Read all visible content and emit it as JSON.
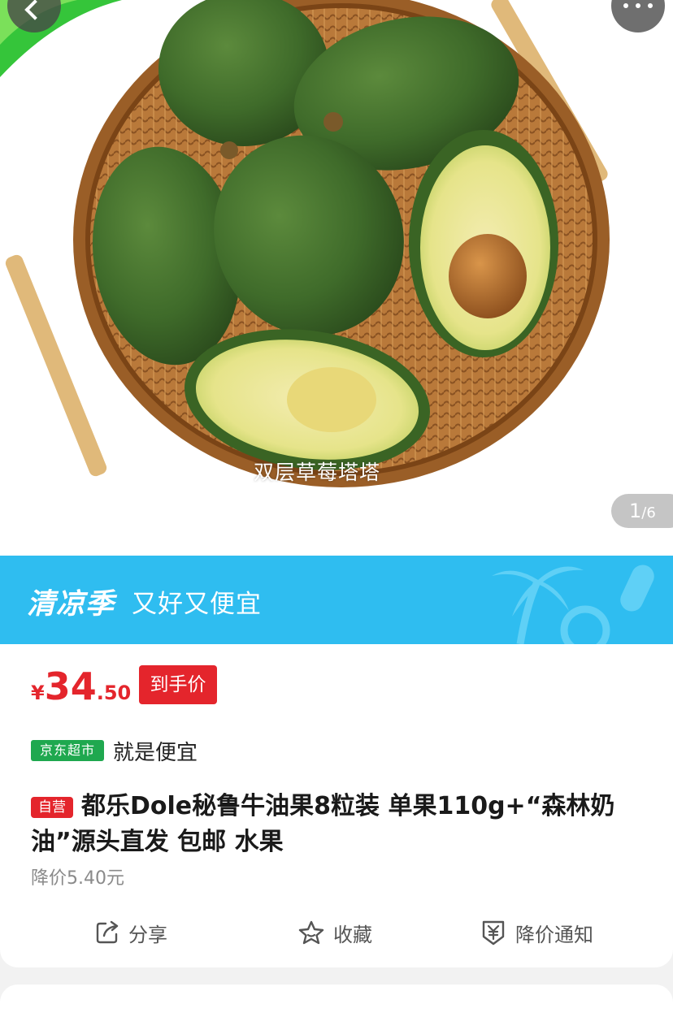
{
  "gallery": {
    "watermark": "双层草莓塔塔",
    "pager_current": "1",
    "pager_separator": "/",
    "pager_total": "6"
  },
  "nav": {
    "back_icon": "chevron-left-icon",
    "more_icon": "more-dots-icon"
  },
  "banner": {
    "title": "清凉季",
    "subtitle": "又好又便宜",
    "background": "#2fbdf0"
  },
  "price": {
    "currency": "¥",
    "integer": "34",
    "decimal": ".50",
    "tag": "到手价",
    "color": "#e4252c"
  },
  "store": {
    "badge": "京东超市",
    "slogan": "就是便宜",
    "badge_color": "#1fa84f"
  },
  "product": {
    "self_badge": "自营",
    "title": "都乐Dole秘鲁牛油果8粒装 单果110g+“森林奶油”源头直发 包邮 水果",
    "price_drop": "降价5.40元"
  },
  "actions": {
    "share": "分享",
    "favorite": "收藏",
    "notify": "降价通知"
  }
}
